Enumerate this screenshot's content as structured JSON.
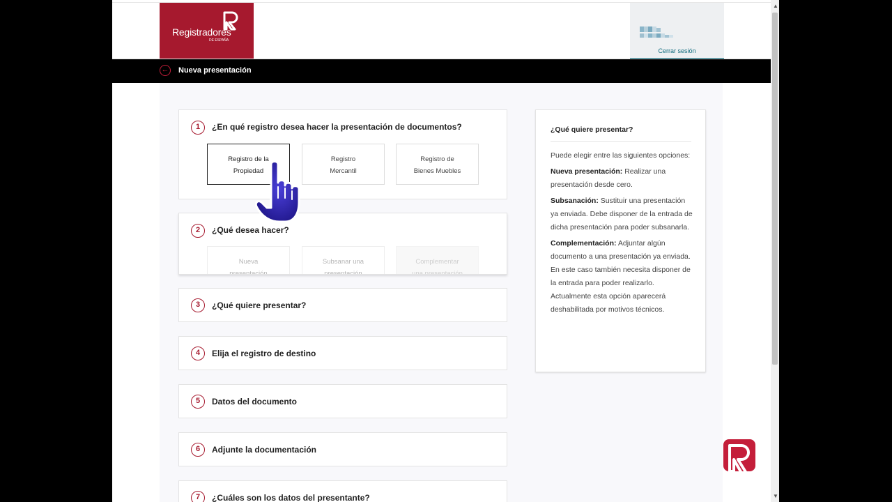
{
  "header": {
    "logo_name": "Registradores",
    "logo_sub": "DE ESPAÑA",
    "logout_label": "Cerrar sesión"
  },
  "navbar": {
    "title": "Nueva presentación",
    "back_icon": "back-arrow-icon"
  },
  "steps": [
    {
      "num": "1",
      "title": "¿En qué registro desea hacer la presentación de documentos?",
      "options": [
        {
          "line1": "Registro de la",
          "line2": "Propiedad"
        },
        {
          "line1": "Registro",
          "line2": "Mercantil"
        },
        {
          "line1": "Registro de",
          "line2": "Bienes Muebles"
        }
      ]
    },
    {
      "num": "2",
      "title": "¿Qué desea hacer?",
      "options": [
        {
          "line1": "Nueva",
          "line2": "presentación"
        },
        {
          "line1": "Subsanar una",
          "line2": "presentación"
        },
        {
          "line1": "Complementar",
          "line2": "una presentación"
        }
      ]
    },
    {
      "num": "3",
      "title": "¿Qué quiere presentar?"
    },
    {
      "num": "4",
      "title": "Elija el registro de destino"
    },
    {
      "num": "5",
      "title": "Datos del documento"
    },
    {
      "num": "6",
      "title": "Adjunte la documentación"
    },
    {
      "num": "7",
      "title": "¿Cuáles son los datos del presentante?"
    }
  ],
  "info_panel": {
    "title": "¿Qué quiere presentar?",
    "intro": "Puede elegir entre las siguientes opciones:",
    "items": [
      {
        "term": "Nueva presentación:",
        "desc": " Realizar una presentación desde cero."
      },
      {
        "term": "Subsanación:",
        "desc": " Sustituir una presentación ya enviada. Debe disponer de la entrada de dicha presentación para poder subsanarla."
      },
      {
        "term": "Complementación:",
        "desc": " Adjuntar algún documento a una presentación ya enviada. En este caso también necesita disponer de la entrada para poder realizarlo. Actualmente esta opción aparecerá deshabilitada por motivos técnicos."
      }
    ]
  },
  "colors": {
    "brand": "#a6192e",
    "accent": "#0c6a7d",
    "cursor": "#2a1fa8"
  }
}
